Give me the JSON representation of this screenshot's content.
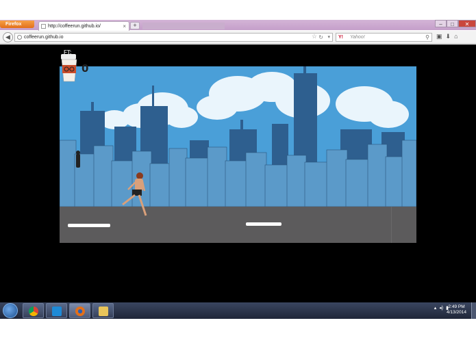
{
  "browser": {
    "menu_button": "Firefox",
    "tab_title": "http://coffeerun.github.io/",
    "tab_close": "×",
    "new_tab": "+",
    "url": "coffeerun.github.io",
    "search_placeholder": "Yahoo!",
    "window_minimize": "–",
    "window_maximize": "□",
    "window_close": "✕"
  },
  "game": {
    "distance_label": "FT:",
    "score": "0"
  },
  "taskbar": {
    "apps": [
      "chrome-icon",
      "webstorm-icon",
      "firefox-icon",
      "file-explorer-icon"
    ],
    "time": "2:49 PM",
    "date": "4/13/2014"
  },
  "colors": {
    "sky": "#4a9fd8",
    "building_dark": "#2e5f8f",
    "building_light": "#5b9ac9",
    "road": "#5c5b5c",
    "lane_mark": "#ffffff",
    "firefox_orange": "#e2701b"
  }
}
